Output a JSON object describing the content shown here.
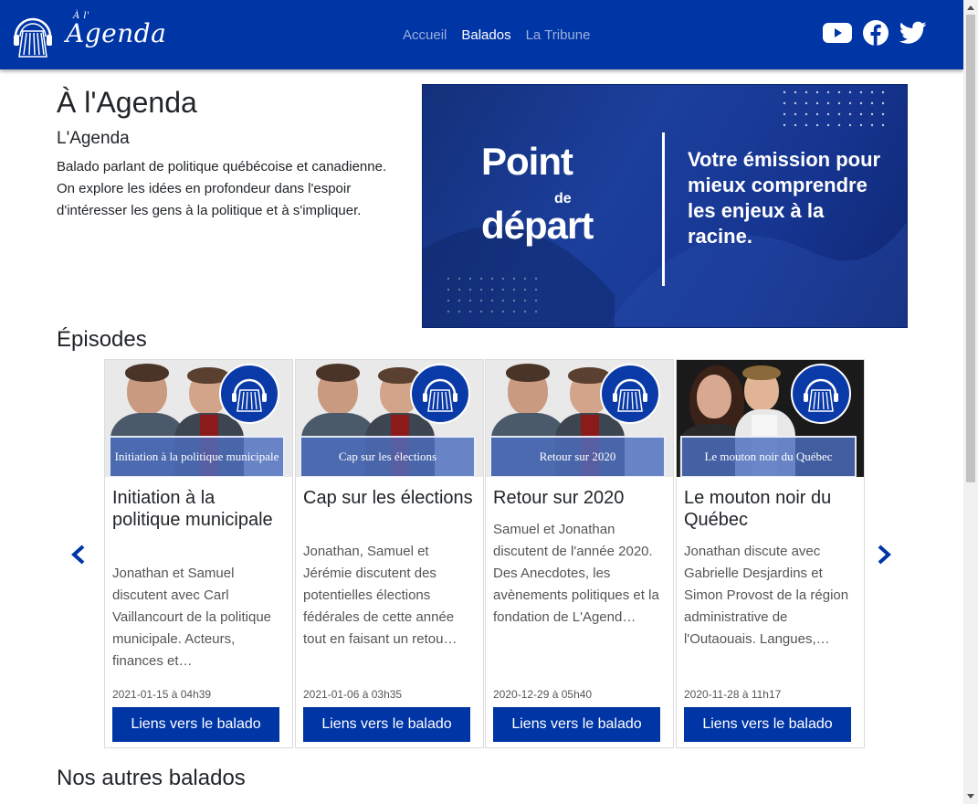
{
  "navbar": {
    "brand_small": "À l'",
    "brand": "Agenda",
    "links": [
      {
        "label": "Accueil"
      },
      {
        "label": "Balados"
      },
      {
        "label": "La Tribune"
      }
    ],
    "social_icons": [
      "youtube-icon",
      "facebook-icon",
      "twitter-icon"
    ],
    "color": "#0035a6"
  },
  "hero": {
    "title": "À l'Agenda",
    "subtitle": "L'Agenda",
    "description": "Balado parlant de politique québécoise et canadienne. On explore les idées en profondeur dans l'espoir d'intéresser les gens à la politique et à s'impliquer."
  },
  "banner": {
    "logo_point": "Point",
    "logo_de": "de",
    "logo_depart": "départ",
    "tagline": "Votre émission pour mieux comprendre les enjeux à la racine."
  },
  "episodes": {
    "title": "Épisodes",
    "items": [
      {
        "caption": "Initiation à la politique municipale",
        "title": "Initiation à la politique municipale",
        "text": "Jonathan et Samuel discutent avec Carl Vaillancourt de la politique municipale. Acteurs, finances et…",
        "date": "2021-01-15 à 04h39",
        "button": "Liens vers le balado"
      },
      {
        "caption": "Cap sur les élections",
        "title": "Cap sur les élections",
        "text": "Jonathan, Samuel et Jérémie discutent des potentielles élections fédérales de cette année tout en faisant un retou…",
        "date": "2021-01-06 à 03h35",
        "button": "Liens vers le balado"
      },
      {
        "caption": "Retour sur 2020",
        "title": "Retour sur 2020",
        "text": "Samuel et Jonathan discutent de l'année 2020. Des Anecdotes, les avènements politiques et la fondation de L'Agend…",
        "date": "2020-12-29 à 05h40",
        "button": "Liens vers le balado"
      },
      {
        "caption": "Le mouton noir du Québec",
        "title": "Le mouton noir du Québec",
        "text": "Jonathan discute avec Gabrielle Desjardins et Simon Provost de la région administrative de l'Outaouais. Langues,…",
        "date": "2020-11-28 à 11h17",
        "button": "Liens vers le balado"
      }
    ]
  },
  "others": {
    "title": "Nos autres balados"
  }
}
